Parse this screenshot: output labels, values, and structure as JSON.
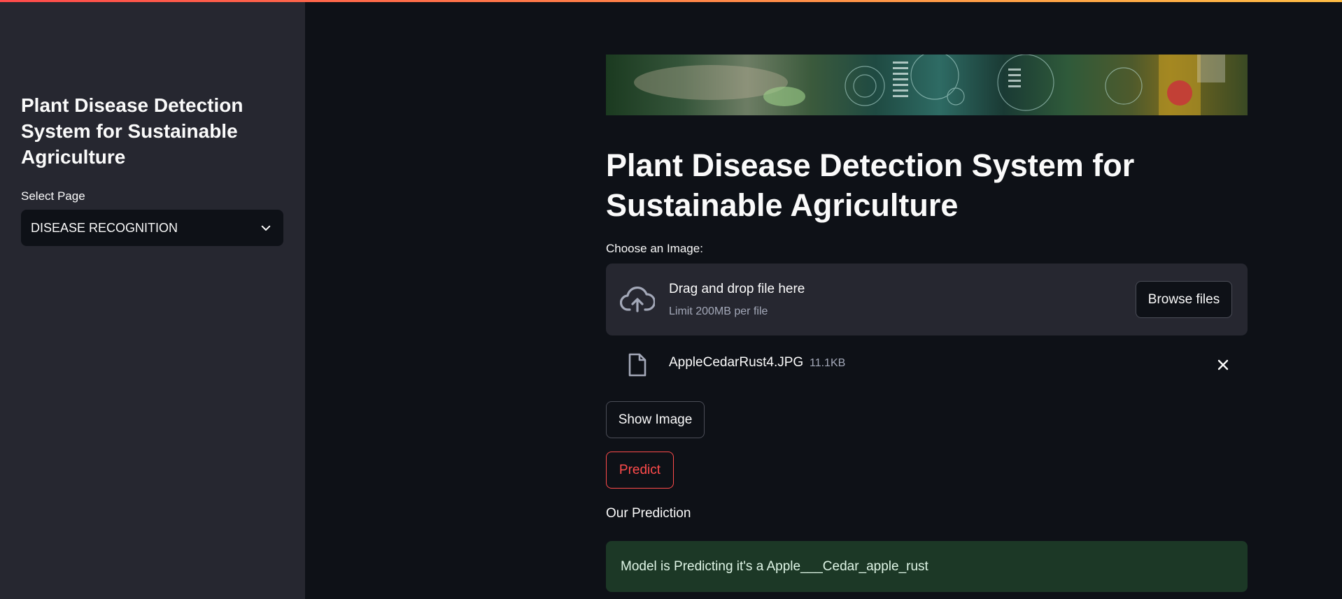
{
  "sidebar": {
    "title": "Plant Disease Detection System for Sustainable Agriculture",
    "select_label": "Select Page",
    "select_value": "DISEASE RECOGNITION"
  },
  "main": {
    "title": "Plant Disease Detection System for Sustainable Agriculture",
    "uploader": {
      "label": "Choose an Image:",
      "drop_text": "Drag and drop file here",
      "limit_text": "Limit 200MB per file",
      "browse_label": "Browse files",
      "icon": "cloud-upload-icon"
    },
    "uploaded_file": {
      "name": "AppleCedarRust4.JPG",
      "size": "11.1KB",
      "icon": "file-icon"
    },
    "show_image_label": "Show Image",
    "predict_label": "Predict",
    "prediction_header": "Our Prediction",
    "prediction_result": "Model is Predicting it's a Apple___Cedar_apple_rust"
  },
  "colors": {
    "background": "#0e1117",
    "sidebar": "#262730",
    "accent": "#ff4b4b",
    "success_bg": "#1c3826"
  }
}
